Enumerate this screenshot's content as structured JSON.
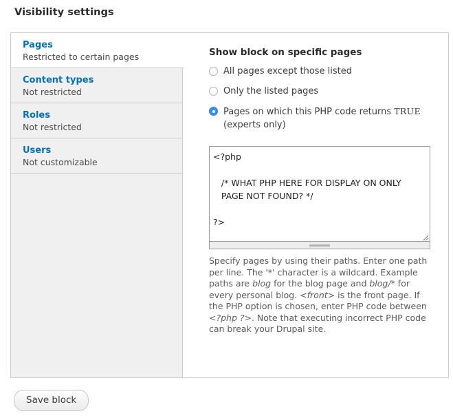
{
  "page": {
    "heading": "Visibility settings",
    "accent_color": "#0071b3",
    "radio_on_color": "#3b8ff0",
    "panel_border_color": "#cccccc",
    "tab_inactive_bg": "#f0f0f0"
  },
  "vertical_tabs": {
    "items": [
      {
        "title": "Pages",
        "summary": "Restricted to certain pages",
        "selected": true
      },
      {
        "title": "Content types",
        "summary": "Not restricted",
        "selected": false
      },
      {
        "title": "Roles",
        "summary": "Not restricted",
        "selected": false
      },
      {
        "title": "Users",
        "summary": "Not customizable",
        "selected": false
      }
    ]
  },
  "pane": {
    "legend": "Show block on specific pages",
    "radios": [
      {
        "label": "All pages except those listed",
        "selected": false
      },
      {
        "label": "Only the listed pages",
        "selected": false
      },
      {
        "label_before": "Pages on which this PHP code returns ",
        "label_code": "TRUE",
        "label_after": "(experts only)",
        "selected": true
      }
    ],
    "textarea": {
      "value": "<?php\n\n   /* WHAT PHP HERE FOR DISPLAY ON ONLY\n   PAGE NOT FOUND? */\n\n?>",
      "placeholder": ""
    },
    "description": {
      "p1": "Specify pages by using their paths. Enter one path per line. The '*' character is a wildcard. Example paths are ",
      "em1": "blog",
      "p2": " for the blog page and ",
      "em2": "blog/*",
      "p3": " for every personal blog. ",
      "em3": "<front>",
      "p4": " is the front page. If the PHP option is chosen, enter PHP code between ",
      "em4": "<?php ?>",
      "p5": ". Note that executing incorrect PHP code can break your Drupal site."
    }
  },
  "actions": {
    "save_label": "Save block"
  }
}
